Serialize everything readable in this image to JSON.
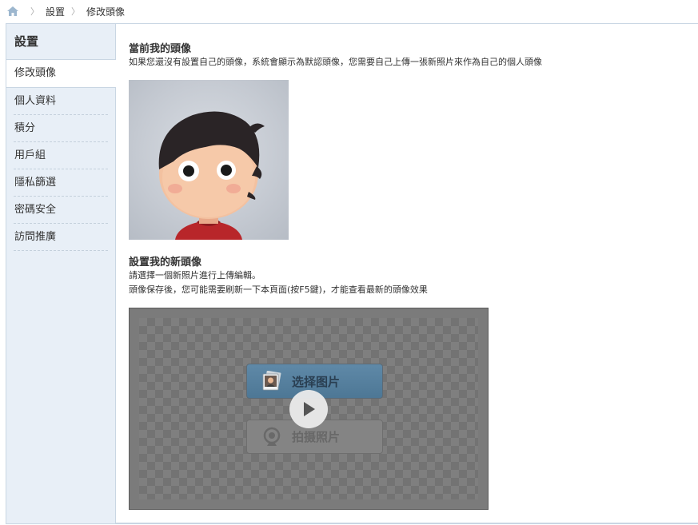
{
  "breadcrumb": {
    "home_icon": "home-icon",
    "items": [
      "設置",
      "修改頭像"
    ]
  },
  "sidebar": {
    "title": "設置",
    "items": [
      {
        "label": "修改頭像",
        "active": true
      },
      {
        "label": "個人資料",
        "active": false
      },
      {
        "label": "積分",
        "active": false
      },
      {
        "label": "用戶組",
        "active": false
      },
      {
        "label": "隱私篩選",
        "active": false
      },
      {
        "label": "密碼安全",
        "active": false
      },
      {
        "label": "訪問推廣",
        "active": false
      }
    ]
  },
  "current_avatar": {
    "title": "當前我的頭像",
    "description": "如果您還沒有設置自己的頭像，系統會顯示為默認頭像，您需要自己上傳一張新照片來作為自己的個人頭像"
  },
  "new_avatar": {
    "title": "設置我的新頭像",
    "description_line1": "請選擇一個新照片進行上傳編輯。",
    "description_line2": "頭像保存後，您可能需要刷新一下本頁面(按F5鍵)，才能查看最新的頭像效果"
  },
  "uploader": {
    "select_button_label": "选择图片",
    "camera_button_label": "拍摄照片",
    "play_icon": "play-icon"
  },
  "colors": {
    "sidebar_bg": "#e8eff7",
    "border": "#c9d6e3",
    "select_button": "#5a84a3",
    "uploader_bg": "#7b7b7b"
  }
}
